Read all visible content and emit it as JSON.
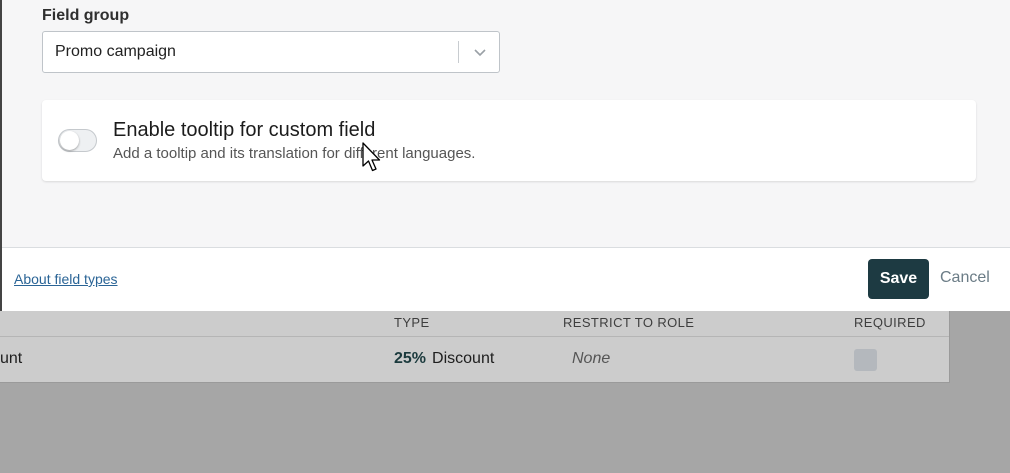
{
  "modal": {
    "field_group_label": "Field group",
    "field_group_value": "Promo campaign",
    "tooltip_title": "Enable tooltip for custom field",
    "tooltip_description": "Add a tooltip and its translation for different languages.",
    "tooltip_enabled": false,
    "footer_link": "About field types",
    "save_label": "Save",
    "cancel_label": "Cancel"
  },
  "table": {
    "headers": [
      "TYPE",
      "RESTRICT TO ROLE",
      "REQUIRED"
    ],
    "row": {
      "name_fragment": "unt",
      "type_badge": "25%",
      "type_label": "Discount",
      "role": "None",
      "required": false
    }
  },
  "icons": [
    "chevron-down-icon",
    "mouse-cursor-icon"
  ],
  "colors": {
    "primary_button": "#1d3a42",
    "link": "#2a6496"
  }
}
